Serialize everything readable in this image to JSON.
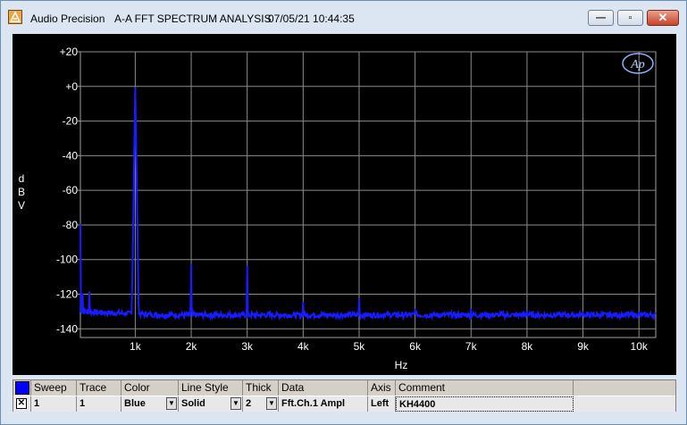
{
  "window": {
    "app_name": "Audio Precision",
    "doc_title": "A-A FFT SPECTRUM ANALYSIS",
    "timestamp": "07/05/21 10:44:35",
    "min_label": "—",
    "max_label": "▫",
    "close_label": "✕"
  },
  "logo": {
    "text": "Ap"
  },
  "chart_data": {
    "type": "line",
    "xlabel": "Hz",
    "ylabel": "dBV",
    "ylabel_letters": [
      "d",
      "B",
      "V"
    ],
    "xlim": [
      20,
      10300
    ],
    "ylim": [
      -145,
      20
    ],
    "x_ticks": [
      1000,
      2000,
      3000,
      4000,
      5000,
      6000,
      7000,
      8000,
      9000,
      10000
    ],
    "x_tick_labels": [
      "1k",
      "2k",
      "3k",
      "4k",
      "5k",
      "6k",
      "7k",
      "8k",
      "9k",
      "10k"
    ],
    "y_ticks": [
      20,
      0,
      -20,
      -40,
      -60,
      -80,
      -100,
      -120,
      -140
    ],
    "y_tick_labels": [
      "+20",
      "+0",
      "-20",
      "-40",
      "-60",
      "-80",
      "-100",
      "-120",
      "-140"
    ],
    "grid": true,
    "series": [
      {
        "color": "#1a1aff",
        "noise_floor_db": -132,
        "peaks": [
          {
            "x": 20,
            "y": -80
          },
          {
            "x": 60,
            "y": -120
          },
          {
            "x": 180,
            "y": -119
          },
          {
            "x": 1000,
            "y": -1
          },
          {
            "x": 2000,
            "y": -103
          },
          {
            "x": 3000,
            "y": -104
          },
          {
            "x": 4000,
            "y": -125
          },
          {
            "x": 5000,
            "y": -123
          },
          {
            "x": 6000,
            "y": -129
          },
          {
            "x": 7000,
            "y": -129
          },
          {
            "x": 8000,
            "y": -130
          },
          {
            "x": 9000,
            "y": -131
          },
          {
            "x": 10000,
            "y": -131
          }
        ]
      }
    ]
  },
  "legend": {
    "headers": [
      "Sweep",
      "Trace",
      "Color",
      "Line Style",
      "Thick",
      "Data",
      "Axis",
      "Comment"
    ],
    "rows": [
      {
        "sweep": "1",
        "trace": "1",
        "color": "Blue",
        "line_style": "Solid",
        "thick": "2",
        "data": "Fft.Ch.1 Ampl",
        "axis": "Left",
        "comment": "KH4400",
        "swatch": "#0000ff",
        "enabled": "✕"
      }
    ]
  }
}
